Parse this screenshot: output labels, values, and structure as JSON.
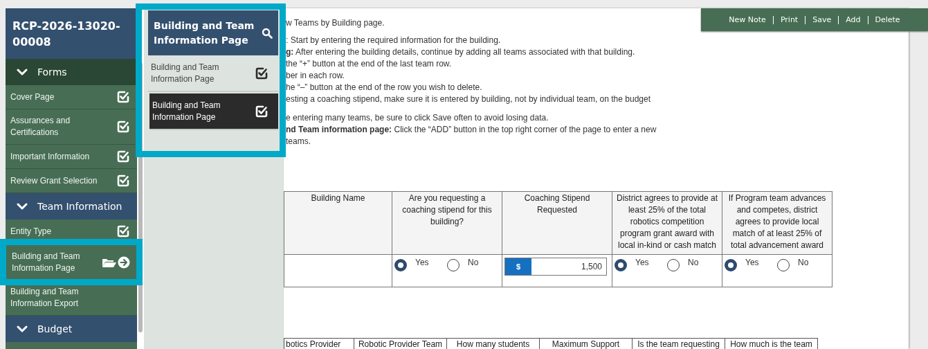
{
  "record_title": "RCP-2026-13020-00008",
  "sidebar": {
    "sections": [
      {
        "label": "Forms",
        "expanded": true,
        "items": [
          {
            "label": "Cover Page",
            "complete": true,
            "selected": false
          },
          {
            "label": "Assurances and Certifications",
            "complete": true,
            "selected": false
          },
          {
            "label": "Important Information",
            "complete": true,
            "selected": false
          },
          {
            "label": "Review Grant Selection",
            "complete": true,
            "selected": false
          }
        ]
      },
      {
        "label": "Team Information",
        "expanded": true,
        "items": [
          {
            "label": "Entity Type",
            "complete": true,
            "selected": false
          },
          {
            "label": "Building and Team Information Page",
            "complete": false,
            "selected": true
          },
          {
            "label": "Building and Team Information Export",
            "complete": false,
            "selected": false
          }
        ]
      },
      {
        "label": "Budget",
        "expanded": true
      }
    ]
  },
  "flyout": {
    "title": "Building and Team Information Page",
    "items": [
      {
        "label": "Building and Team Information Page",
        "complete": true,
        "selected": false
      },
      {
        "label": "Building and Team Information Page",
        "complete": true,
        "selected": true
      }
    ]
  },
  "toolbar": {
    "actions": [
      "New Note",
      "Print",
      "Save",
      "Add",
      "Delete"
    ]
  },
  "instructions": [
    [
      "w Teams by Building page."
    ],
    [
      ": Start by entering the required information for the building.",
      "**g:** After entering the building details, continue by adding all teams associated with that building.",
      "the “+” button at the end of the last team row.",
      "ber in each row.",
      "he “–” button at the end of the row you wish to delete.",
      "esting a coaching stipend, make sure it is entered by building, not by individual team, on the budget"
    ],
    [
      "e entering many teams, be sure to click Save often to avoid losing data.",
      "**nd Team information page:** Click the “ADD” button in the top right corner of the page to enter a new",
      "teams."
    ]
  ],
  "building_table": {
    "columns": [
      "Building Name",
      "Are you requesting a coaching stipend for this building?",
      "Coaching Stipend Requested",
      "District agrees to provide at least 25% of the total robotics competition program grant award with local in-kind or cash match",
      "If Program team advances and competes, district agrees to provide local match of at least 25% of total advancement award"
    ],
    "rows": [
      {
        "cells": [
          {
            "kind": "text"
          },
          {
            "kind": "radio",
            "options": [
              {
                "label": "Yes",
                "selected": true
              },
              {
                "label": "No",
                "selected": false
              }
            ]
          },
          {
            "kind": "currency",
            "prefix": "$",
            "value": "1,500"
          },
          {
            "kind": "radio",
            "options": [
              {
                "label": "Yes",
                "selected": true
              },
              {
                "label": "No",
                "selected": false
              }
            ]
          },
          {
            "kind": "radio",
            "options": [
              {
                "label": "Yes",
                "selected": true
              },
              {
                "label": "No",
                "selected": false
              }
            ]
          }
        ]
      }
    ]
  },
  "team_table": {
    "columns": [
      "botics Provider",
      "Robotic Provider Team",
      "How many students",
      "Maximum Support",
      "Is the team requesting",
      "How much is the team"
    ]
  }
}
